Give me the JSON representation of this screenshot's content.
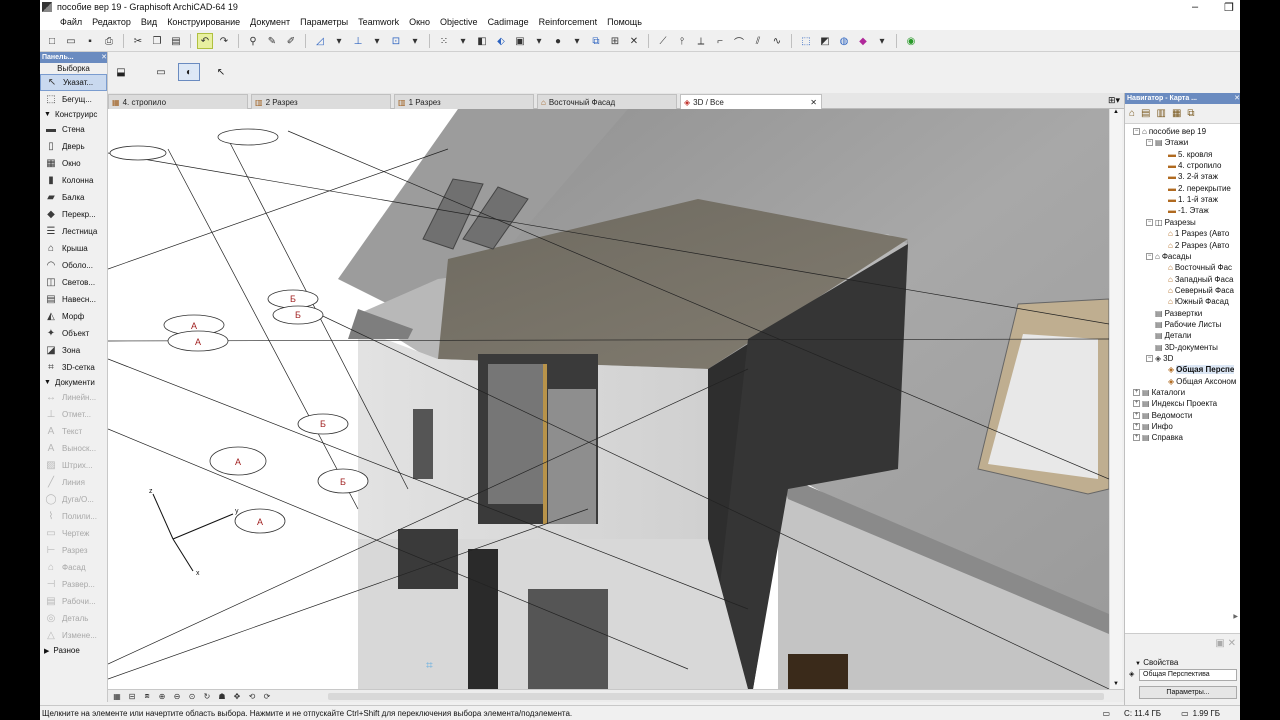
{
  "window": {
    "title": "пособие вер 19 - Graphisoft ArchiCAD-64 19",
    "minimize": "–",
    "maximize": "❐",
    "close": "✕"
  },
  "menu": [
    "Файл",
    "Редактор",
    "Вид",
    "Конструирование",
    "Документ",
    "Параметры",
    "Teamwork",
    "Окно",
    "Objective",
    "Cadimage",
    "Reinforcement",
    "Помощь"
  ],
  "left_panel": {
    "header": "Панель...",
    "header_close": "✕",
    "selection_label": "Выборка",
    "selected_tool": {
      "icon": "arrow-pointer-icon",
      "label": "Указат..."
    },
    "marquee_tool": {
      "icon": "marquee-icon",
      "label": "Бегущ..."
    },
    "groups": [
      {
        "label": "Конструирс",
        "items": [
          {
            "label": "Стена",
            "icon": "wall-icon"
          },
          {
            "label": "Дверь",
            "icon": "door-icon"
          },
          {
            "label": "Окно",
            "icon": "window-icon"
          },
          {
            "label": "Колонна",
            "icon": "column-icon"
          },
          {
            "label": "Балка",
            "icon": "beam-icon"
          },
          {
            "label": "Перекр...",
            "icon": "slab-icon"
          },
          {
            "label": "Лестница",
            "icon": "stair-icon"
          },
          {
            "label": "Крыша",
            "icon": "roof-icon"
          },
          {
            "label": "Оболо...",
            "icon": "shell-icon"
          },
          {
            "label": "Светов...",
            "icon": "skylight-icon"
          },
          {
            "label": "Навесн...",
            "icon": "curtain-wall-icon"
          },
          {
            "label": "Морф",
            "icon": "morph-icon"
          },
          {
            "label": "Объект",
            "icon": "object-icon"
          },
          {
            "label": "Зона",
            "icon": "zone-icon"
          },
          {
            "label": "3D-сетка",
            "icon": "mesh-icon"
          }
        ]
      },
      {
        "label": "Документи",
        "items": [
          {
            "label": "Линейн...",
            "icon": "dimension-icon"
          },
          {
            "label": "Отмет...",
            "icon": "level-dimension-icon"
          },
          {
            "label": "Текст",
            "icon": "text-icon"
          },
          {
            "label": "Выноск...",
            "icon": "label-icon"
          },
          {
            "label": "Штрих...",
            "icon": "fill-icon"
          },
          {
            "label": "Линия",
            "icon": "line-icon"
          },
          {
            "label": "Дуга/О...",
            "icon": "arc-icon"
          },
          {
            "label": "Полили...",
            "icon": "polyline-icon"
          },
          {
            "label": "Чертеж",
            "icon": "drawing-icon"
          },
          {
            "label": "Разрез",
            "icon": "section-icon"
          },
          {
            "label": "Фасад",
            "icon": "elevation-icon"
          },
          {
            "label": "Развер...",
            "icon": "interior-elevation-icon"
          },
          {
            "label": "Рабочи...",
            "icon": "worksheet-icon"
          },
          {
            "label": "Деталь",
            "icon": "detail-icon"
          },
          {
            "label": "Измене...",
            "icon": "change-icon"
          }
        ]
      }
    ],
    "more_group": "Разное"
  },
  "tabs": [
    {
      "label": "4. стропило",
      "icon": "floor-plan-icon"
    },
    {
      "label": "2 Разрез",
      "icon": "section-icon"
    },
    {
      "label": "1 Разрез",
      "icon": "section-icon"
    },
    {
      "label": "Восточный Фасад",
      "icon": "elevation-icon"
    },
    {
      "label": "3D / Все",
      "icon": "3d-view-icon",
      "close": "✕"
    }
  ],
  "viewport": {
    "axis_labels": {
      "x": "x",
      "y": "y",
      "z": "z"
    },
    "grid_bubbles": [
      "А",
      "А",
      "Б",
      "Б",
      "Б",
      "А",
      "Б",
      "А"
    ]
  },
  "navigator": {
    "header": "Навигатор - Карта ...",
    "close": "✕",
    "tree": [
      {
        "level": 0,
        "exp": "−",
        "icon": "project-icon",
        "label": "пособие вер 19"
      },
      {
        "level": 1,
        "exp": "−",
        "icon": "stories-icon",
        "label": "Этажи"
      },
      {
        "level": 2,
        "icon": "story-icon",
        "label": "5. кровля"
      },
      {
        "level": 2,
        "icon": "story-icon",
        "label": "4. стропило"
      },
      {
        "level": 2,
        "icon": "story-icon",
        "label": "3. 2-й этаж"
      },
      {
        "level": 2,
        "icon": "story-icon",
        "label": "2. перекрытие"
      },
      {
        "level": 2,
        "icon": "story-icon",
        "label": "1. 1-й этаж"
      },
      {
        "level": 2,
        "icon": "story-icon",
        "label": "-1. Этаж"
      },
      {
        "level": 1,
        "exp": "−",
        "icon": "sections-icon",
        "label": "Разрезы"
      },
      {
        "level": 2,
        "icon": "section-view-icon",
        "label": "1 Разрез (Авто"
      },
      {
        "level": 2,
        "icon": "section-view-icon",
        "label": "2 Разрез (Авто"
      },
      {
        "level": 1,
        "exp": "−",
        "icon": "elevations-icon",
        "label": "Фасады"
      },
      {
        "level": 2,
        "icon": "elevation-view-icon",
        "label": "Восточный Фас"
      },
      {
        "level": 2,
        "icon": "elevation-view-icon",
        "label": "Западный Фаса"
      },
      {
        "level": 2,
        "icon": "elevation-view-icon",
        "label": "Северный Фаса"
      },
      {
        "level": 2,
        "icon": "elevation-view-icon",
        "label": "Южный Фасад"
      },
      {
        "level": 1,
        "icon": "interior-elevations-icon",
        "label": "Развертки"
      },
      {
        "level": 1,
        "icon": "worksheets-icon",
        "label": "Рабочие Листы"
      },
      {
        "level": 1,
        "icon": "details-icon",
        "label": "Детали"
      },
      {
        "level": 1,
        "icon": "3d-documents-icon",
        "label": "3D-документы"
      },
      {
        "level": 1,
        "exp": "−",
        "icon": "3d-folder-icon",
        "label": "3D"
      },
      {
        "level": 2,
        "icon": "perspective-icon",
        "label": "Общая Перспе",
        "bold": true,
        "selected": true
      },
      {
        "level": 2,
        "icon": "axonometry-icon",
        "label": "Общая Аксоном"
      },
      {
        "level": 0,
        "exp": "+",
        "icon": "schedules-icon",
        "label": "Каталоги"
      },
      {
        "level": 0,
        "exp": "+",
        "icon": "indexes-icon",
        "label": "Индексы Проекта"
      },
      {
        "level": 0,
        "exp": "+",
        "icon": "lists-icon",
        "label": "Ведомости"
      },
      {
        "level": 0,
        "exp": "+",
        "icon": "info-icon",
        "label": "Инфо"
      },
      {
        "level": 0,
        "exp": "+",
        "icon": "help-icon",
        "label": "Справка"
      }
    ],
    "properties": {
      "title": "Свойства",
      "view_name": "Общая Перспектива",
      "params_button": "Параметры..."
    }
  },
  "status": {
    "message": "Щелкните на элементе или начертите область выбора. Нажмите и не отпускайте Ctrl+Shift для переключения выбора элемента/подэлемента.",
    "disk": "C: 11.4 ГБ",
    "memory": "1.99 ГБ"
  }
}
